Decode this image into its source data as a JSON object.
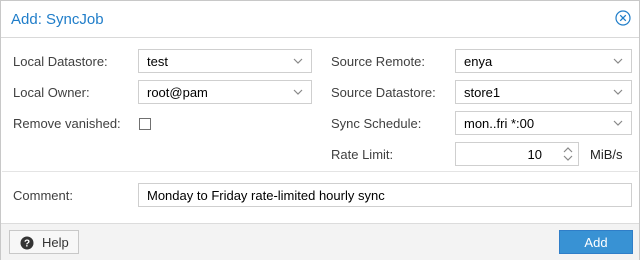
{
  "dialog": {
    "title": "Add: SyncJob",
    "close_icon": "close-circle-icon"
  },
  "form": {
    "local_datastore": {
      "label": "Local Datastore:",
      "value": "test"
    },
    "local_owner": {
      "label": "Local Owner:",
      "value": "root@pam"
    },
    "remove_vanished": {
      "label": "Remove vanished:",
      "checked": false
    },
    "source_remote": {
      "label": "Source Remote:",
      "value": "enya"
    },
    "source_datastore": {
      "label": "Source Datastore:",
      "value": "store1"
    },
    "sync_schedule": {
      "label": "Sync Schedule:",
      "value": "mon..fri *:00"
    },
    "rate_limit": {
      "label": "Rate Limit:",
      "value": "10",
      "unit": "MiB/s"
    },
    "comment": {
      "label": "Comment:",
      "value": "Monday to Friday rate-limited hourly sync"
    }
  },
  "footer": {
    "help_label": "Help",
    "help_icon": "question-circle-icon",
    "add_label": "Add"
  },
  "colors": {
    "title": "#1f7dc9",
    "primary_button": "#3892d4"
  }
}
